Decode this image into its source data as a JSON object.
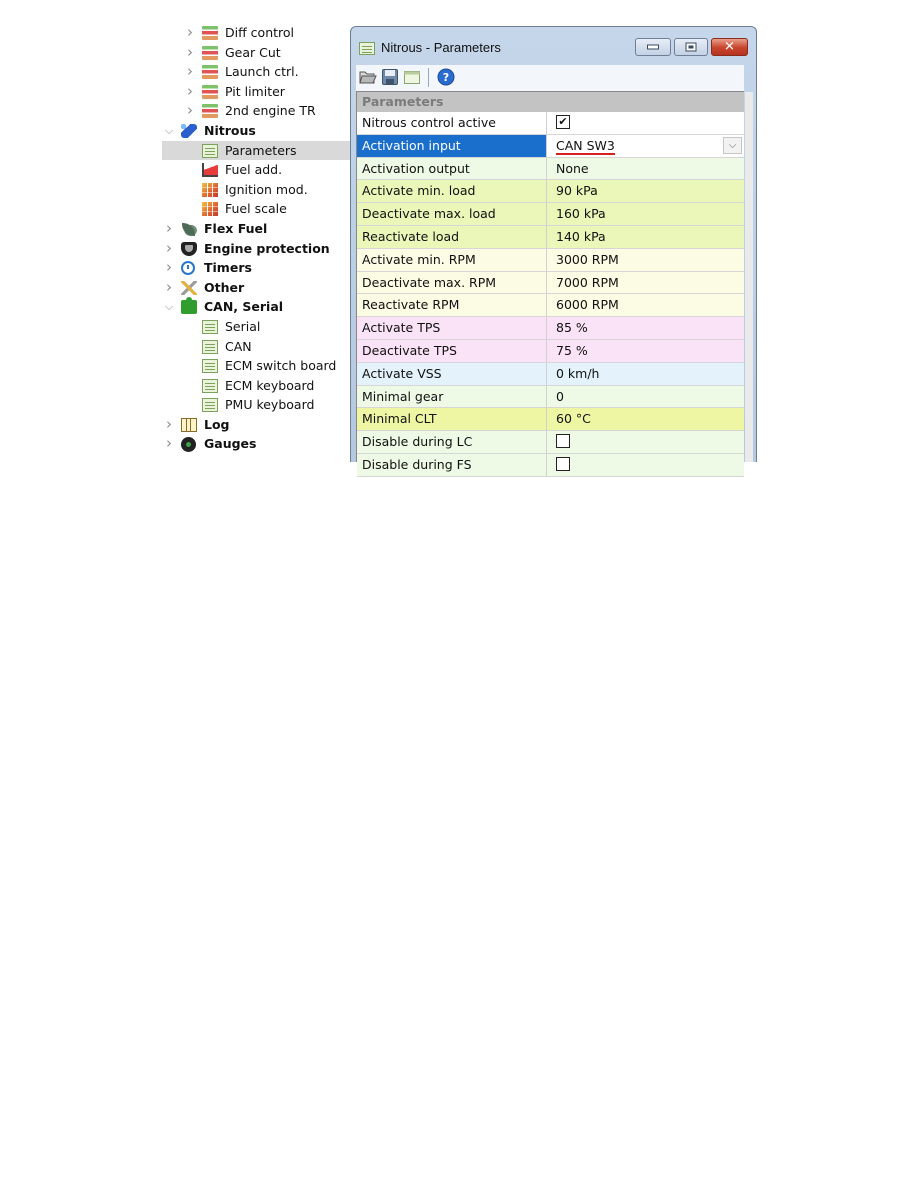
{
  "tree": {
    "items": [
      {
        "label": "Diff control",
        "level": 1,
        "icon": "table-stack-icon",
        "expander": "collapsed"
      },
      {
        "label": "Gear Cut",
        "level": 1,
        "icon": "table-stack-icon",
        "expander": "collapsed"
      },
      {
        "label": "Launch ctrl.",
        "level": 1,
        "icon": "table-stack-icon",
        "expander": "collapsed"
      },
      {
        "label": "Pit limiter",
        "level": 1,
        "icon": "table-stack-icon",
        "expander": "collapsed"
      },
      {
        "label": "2nd engine TR",
        "level": 1,
        "icon": "table-stack-icon",
        "expander": "collapsed"
      },
      {
        "label": "Nitrous",
        "level": 0,
        "icon": "nitrous-bottle-icon",
        "expander": "expanded"
      },
      {
        "label": "Parameters",
        "level": 1,
        "icon": "parameters-grid-icon",
        "expander": "none",
        "selected": true
      },
      {
        "label": "Fuel add.",
        "level": 1,
        "icon": "fuel-add-chart-icon",
        "expander": "none"
      },
      {
        "label": "Ignition mod.",
        "level": 1,
        "icon": "map-table-icon",
        "expander": "none"
      },
      {
        "label": "Fuel scale",
        "level": 1,
        "icon": "map-table-icon",
        "expander": "none"
      },
      {
        "label": "Flex Fuel",
        "level": 0,
        "icon": "leaf-icon",
        "expander": "collapsed"
      },
      {
        "label": "Engine protection",
        "level": 0,
        "icon": "shield-icon",
        "expander": "collapsed"
      },
      {
        "label": "Timers",
        "level": 0,
        "icon": "stopwatch-icon",
        "expander": "collapsed"
      },
      {
        "label": "Other",
        "level": 0,
        "icon": "tools-icon",
        "expander": "collapsed"
      },
      {
        "label": "CAN, Serial",
        "level": 0,
        "icon": "puzzle-icon",
        "expander": "expanded"
      },
      {
        "label": "Serial",
        "level": 1,
        "icon": "parameters-grid-icon",
        "expander": "none"
      },
      {
        "label": "CAN",
        "level": 1,
        "icon": "parameters-grid-icon",
        "expander": "none"
      },
      {
        "label": "ECM switch board",
        "level": 1,
        "icon": "parameters-grid-icon",
        "expander": "none"
      },
      {
        "label": "ECM keyboard",
        "level": 1,
        "icon": "parameters-grid-icon",
        "expander": "none"
      },
      {
        "label": "PMU keyboard",
        "level": 1,
        "icon": "parameters-grid-icon",
        "expander": "none"
      },
      {
        "label": "Log",
        "level": 0,
        "icon": "log-table-icon",
        "expander": "collapsed"
      },
      {
        "label": "Gauges",
        "level": 0,
        "icon": "gauge-icon",
        "expander": "collapsed"
      }
    ]
  },
  "window": {
    "title": "Nitrous - Parameters",
    "buttons": {
      "minimize": "minimize",
      "maximize": "maximize",
      "close": "close"
    },
    "toolbar": [
      "open-icon",
      "save-icon",
      "view-icon",
      "help-icon"
    ],
    "section_title": "Parameters",
    "rows": [
      {
        "label": "Nitrous control active",
        "type": "checkbox",
        "checked": true,
        "color": "white"
      },
      {
        "label": "Activation input",
        "type": "dropdown",
        "value": "CAN SW3",
        "selected": true,
        "color": "white"
      },
      {
        "label": "Activation output",
        "type": "text",
        "value": "None",
        "color": "mint"
      },
      {
        "label": "Activate min. load",
        "type": "text",
        "value": "90 kPa",
        "color": "lime"
      },
      {
        "label": "Deactivate max. load",
        "type": "text",
        "value": "160 kPa",
        "color": "lime"
      },
      {
        "label": "Reactivate load",
        "type": "text",
        "value": "140 kPa",
        "color": "lime"
      },
      {
        "label": "Activate min. RPM",
        "type": "text",
        "value": "3000 RPM",
        "color": "cream"
      },
      {
        "label": "Deactivate max. RPM",
        "type": "text",
        "value": "7000 RPM",
        "color": "cream"
      },
      {
        "label": "Reactivate RPM",
        "type": "text",
        "value": "6000 RPM",
        "color": "cream"
      },
      {
        "label": "Activate TPS",
        "type": "text",
        "value": "85 %",
        "color": "pink"
      },
      {
        "label": "Deactivate TPS",
        "type": "text",
        "value": "75 %",
        "color": "pink"
      },
      {
        "label": "Activate VSS",
        "type": "text",
        "value": "0 km/h",
        "color": "blue"
      },
      {
        "label": "Minimal gear",
        "type": "text",
        "value": "0",
        "color": "mint"
      },
      {
        "label": "Minimal CLT",
        "type": "text",
        "value": "60 °C",
        "color": "yellow"
      },
      {
        "label": "Disable during LC",
        "type": "checkbox",
        "checked": false,
        "color": "mint"
      },
      {
        "label": "Disable during FS",
        "type": "checkbox",
        "checked": false,
        "color": "mint"
      }
    ],
    "check_glyph": "✔",
    "dropdown_glyph": "⌵"
  },
  "colors": {
    "selection_blue": "#1a6fcc",
    "spellcheck_underline": "#d42020",
    "close_button": "#c8432c"
  }
}
